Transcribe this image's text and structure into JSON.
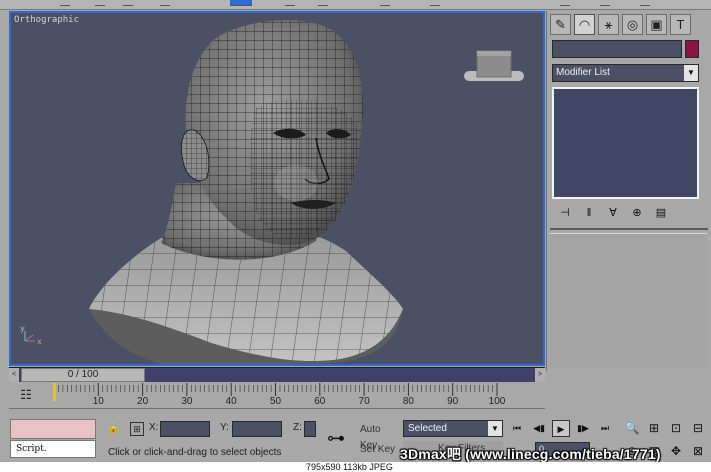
{
  "viewport": {
    "label": "Orthographic"
  },
  "command_panel": {
    "tabs": [
      {
        "name": "create-tab",
        "glyph": "✎"
      },
      {
        "name": "modify-tab",
        "glyph": "◠"
      },
      {
        "name": "hierarchy-tab",
        "glyph": "⚹"
      },
      {
        "name": "motion-tab",
        "glyph": "◎"
      },
      {
        "name": "display-tab",
        "glyph": "▣"
      },
      {
        "name": "utilities-tab",
        "glyph": "T"
      }
    ],
    "modifier_list": "Modifier List",
    "modifier_arrow": "▼",
    "object_color": "#8a1540",
    "stack_tools": [
      "⊣",
      "‖",
      "∀",
      "⊕",
      "▤"
    ]
  },
  "time_slider": {
    "label": "0 / 100",
    "prev": "<",
    "next": ">"
  },
  "trackbar": {
    "ticks": [
      "10",
      "20",
      "30",
      "40",
      "50",
      "60",
      "70",
      "80",
      "90",
      "100"
    ]
  },
  "status": {
    "script_label": "Script.",
    "coord_x_label": "X:",
    "coord_y_label": "Y:",
    "coord_z_label": "Z:",
    "prompt": "Click or click-and-drag to select objects",
    "auto_key": "Auto Key",
    "set_key": "Set Key",
    "selected": "Selected",
    "selected_arrow": "▼",
    "key_filters": "Key Filters...",
    "frame_value": "0",
    "playback": [
      "⏮",
      "◀▮",
      "▶",
      "▮▶",
      "⏭"
    ],
    "nav_tools": [
      "🔍",
      "⊞",
      "⊡",
      "⊟",
      "⊕",
      "▦",
      "✥",
      "⊠"
    ]
  },
  "watermark": "3Dmax吧 (www.linecg.com/tieba/1771)",
  "caption": "795x590  113kb  JPEG",
  "colors": {
    "viewport_bg": "#4b5065",
    "active_border": "#2a6bd6",
    "timeline_bg": "#41406a"
  }
}
